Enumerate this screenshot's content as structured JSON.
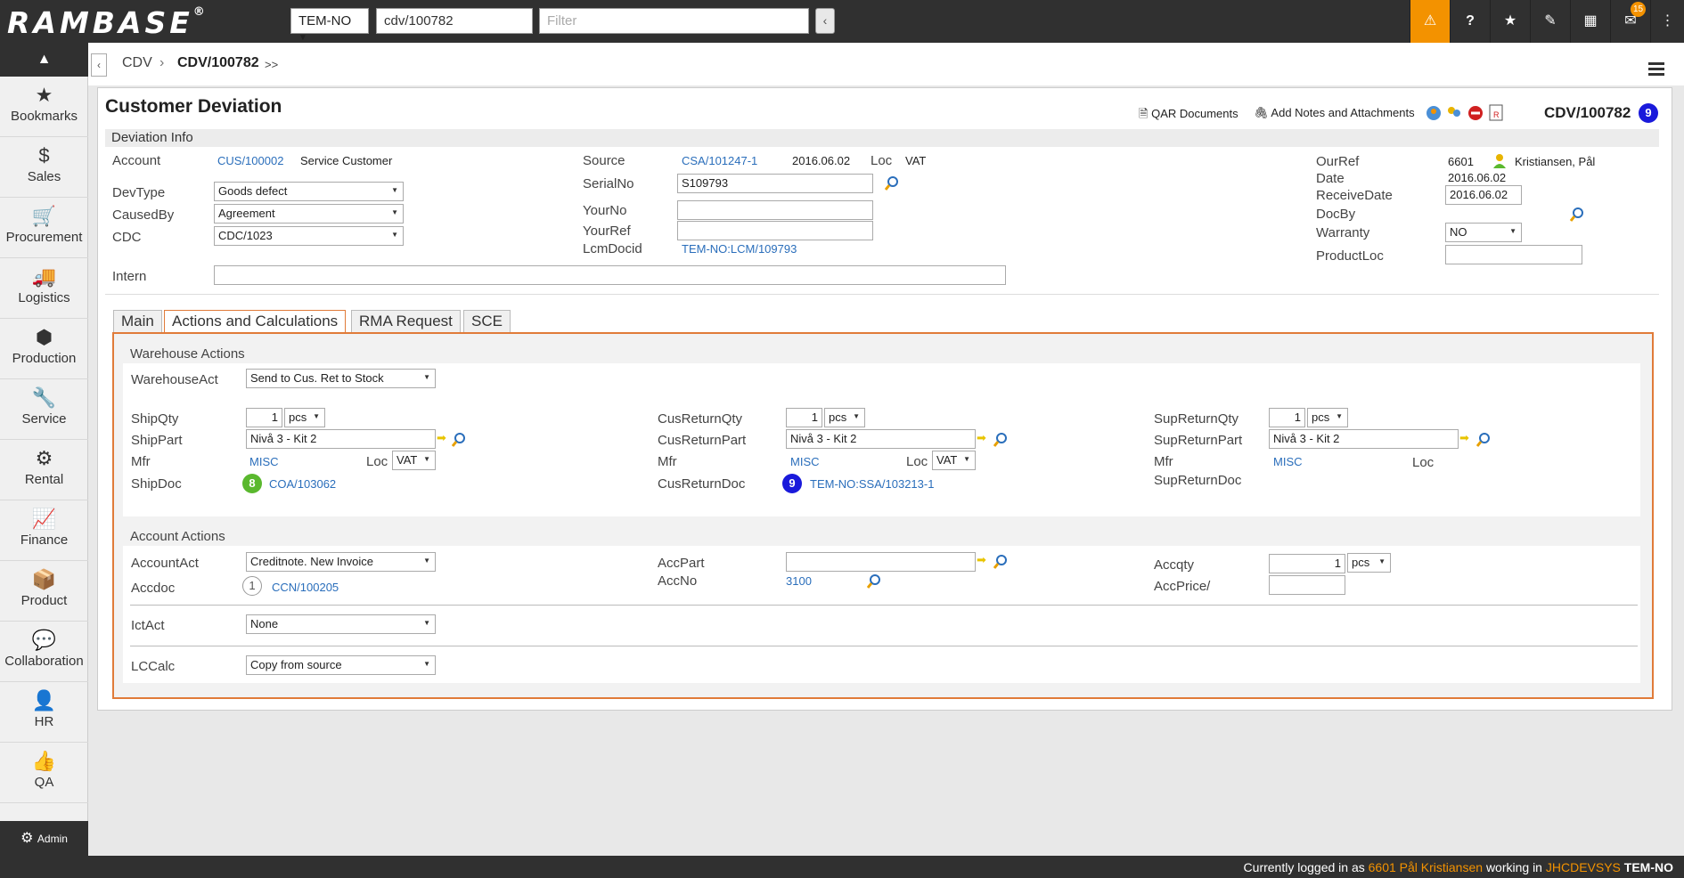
{
  "topbar": {
    "logo": "RAMBASE",
    "logo_reg": "®",
    "company": "TEM-NO",
    "search_value": "cdv/100782",
    "filter_placeholder": "Filter",
    "mail_count": "15"
  },
  "sidebar": {
    "items": [
      {
        "label": "Bookmarks",
        "icon": "★"
      },
      {
        "label": "Sales",
        "icon": "$"
      },
      {
        "label": "Procurement",
        "icon": "🛒"
      },
      {
        "label": "Logistics",
        "icon": "🚚"
      },
      {
        "label": "Production",
        "icon": "⬢"
      },
      {
        "label": "Service",
        "icon": "🔧"
      },
      {
        "label": "Rental",
        "icon": "⚙"
      },
      {
        "label": "Finance",
        "icon": "📈"
      },
      {
        "label": "Product",
        "icon": "📦"
      },
      {
        "label": "Collaboration",
        "icon": "💬"
      },
      {
        "label": "HR",
        "icon": "👤"
      },
      {
        "label": "QA",
        "icon": "👍"
      },
      {
        "label": "Admin",
        "icon": "⚙"
      }
    ]
  },
  "breadcrumb": {
    "root": "CDV",
    "current": "CDV/100782",
    "more": ">>"
  },
  "header": {
    "title": "Customer Deviation",
    "qar_documents": "QAR Documents",
    "add_notes": "Add Notes and Attachments",
    "doc_id": "CDV/100782",
    "status": "9"
  },
  "deviation_info": {
    "section_label": "Deviation Info",
    "account_label": "Account",
    "account_link": "CUS/100002",
    "account_name": "Service Customer",
    "devtype_label": "DevType",
    "devtype_value": "Goods defect",
    "causedby_label": "CausedBy",
    "causedby_value": "Agreement",
    "cdc_label": "CDC",
    "cdc_value": "CDC/1023",
    "intern_label": "Intern",
    "source_label": "Source",
    "source_link": "CSA/101247-1",
    "source_date": "2016.06.02",
    "loc_label": "Loc",
    "loc_value": "VAT",
    "serialno_label": "SerialNo",
    "serialno_value": "S109793",
    "yourno_label": "YourNo",
    "yourref_label": "YourRef",
    "lcmdocid_label": "LcmDocid",
    "lcmdocid_link": "TEM-NO:LCM/109793",
    "ourref_label": "OurRef",
    "ourref_value": "6601",
    "ourref_name": "Kristiansen, Pål",
    "date_label": "Date",
    "date_value": "2016.06.02",
    "receivedate_label": "ReceiveDate",
    "receivedate_value": "2016.06.02",
    "docby_label": "DocBy",
    "warranty_label": "Warranty",
    "warranty_value": "NO",
    "productloc_label": "ProductLoc"
  },
  "tabs": [
    {
      "label": "Main"
    },
    {
      "label": "Actions and Calculations"
    },
    {
      "label": "RMA Request"
    },
    {
      "label": "SCE"
    }
  ],
  "warehouse": {
    "section_label": "Warehouse Actions",
    "warehouseact_label": "WarehouseAct",
    "warehouseact_value": "Send to Cus. Ret to Stock",
    "shipqty_label": "ShipQty",
    "shipqty_value": "1",
    "shipqty_unit": "pcs",
    "shippart_label": "ShipPart",
    "shippart_value": "Nivå 3 - Kit 2",
    "mfr_label": "Mfr",
    "mfr_link": "MISC",
    "loc_label": "Loc",
    "loc_value": "VAT",
    "shipdoc_label": "ShipDoc",
    "shipdoc_status": "8",
    "shipdoc_link": "COA/103062",
    "cusreturnqty_label": "CusReturnQty",
    "cusreturnqty_value": "1",
    "cusreturnqty_unit": "pcs",
    "cusreturnpart_label": "CusReturnPart",
    "cusreturnpart_value": "Nivå 3 - Kit 2",
    "cus_mfr_label": "Mfr",
    "cus_mfr_link": "MISC",
    "cus_loc_label": "Loc",
    "cus_loc_value": "VAT",
    "cusreturndoc_label": "CusReturnDoc",
    "cusreturndoc_status": "9",
    "cusreturndoc_link": "TEM-NO:SSA/103213-1",
    "supreturnqty_label": "SupReturnQty",
    "supreturnqty_value": "1",
    "supreturnqty_unit": "pcs",
    "supreturnpart_label": "SupReturnPart",
    "supreturnpart_value": "Nivå 3 - Kit 2",
    "sup_mfr_label": "Mfr",
    "sup_mfr_link": "MISC",
    "sup_loc_label": "Loc",
    "supreturndoc_label": "SupReturnDoc"
  },
  "account": {
    "section_label": "Account Actions",
    "accountact_label": "AccountAct",
    "accountact_value": "Creditnote. New Invoice",
    "accdoc_label": "Accdoc",
    "accdoc_status": "1",
    "accdoc_link": "CCN/100205",
    "accpart_label": "AccPart",
    "accno_label": "AccNo",
    "accno_link": "3100",
    "accqty_label": "Accqty",
    "accqty_value": "1",
    "accqty_unit": "pcs",
    "accprice_label": "AccPrice/",
    "ictact_label": "IctAct",
    "ictact_value": "None",
    "lccalc_label": "LCCalc",
    "lccalc_value": "Copy from source"
  },
  "statusbar": {
    "prefix": "Currently logged in as",
    "user": "6601 Pål Kristiansen",
    "middle": "working in",
    "system": "JHCDEVSYS",
    "company": "TEM-NO"
  },
  "colors": {
    "accent": "#f39200",
    "link": "#2a6ebb",
    "tab_border": "#e07b39",
    "status_green": "#5ab82e",
    "status_blue": "#1a1adb"
  }
}
